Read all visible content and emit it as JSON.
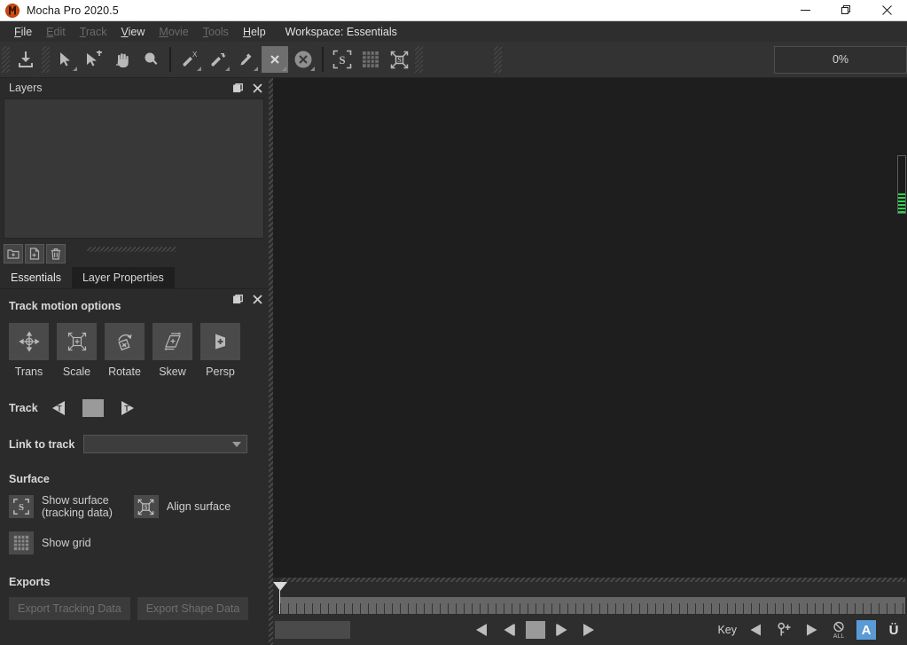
{
  "window": {
    "title": "Mocha Pro 2020.5",
    "logo_icon": "mocha-logo-icon",
    "controls": {
      "minimize": "minimize-icon",
      "restore": "restore-icon",
      "close": "close-icon"
    }
  },
  "menubar": {
    "items": [
      {
        "label": "File",
        "mnemonic": "F",
        "enabled": true
      },
      {
        "label": "Edit",
        "mnemonic": "E",
        "enabled": false
      },
      {
        "label": "Track",
        "mnemonic": "T",
        "enabled": false
      },
      {
        "label": "View",
        "mnemonic": "V",
        "enabled": true
      },
      {
        "label": "Movie",
        "mnemonic": "M",
        "enabled": false
      },
      {
        "label": "Tools",
        "mnemonic": "T",
        "enabled": false
      },
      {
        "label": "Help",
        "mnemonic": "H",
        "enabled": true
      }
    ],
    "workspace": "Workspace: Essentials"
  },
  "toolbar": {
    "buttons": [
      {
        "name": "import-clip-icon",
        "title": "Import Clip"
      },
      {
        "name": "select-tool-icon",
        "title": "Select Tool"
      },
      {
        "name": "add-point-tool-icon",
        "title": "Add Point Tool"
      },
      {
        "name": "pan-hand-tool-icon",
        "title": "Pan Tool"
      },
      {
        "name": "zoom-magnifier-tool-icon",
        "title": "Zoom Tool"
      },
      {
        "name": "x-spline-tool-icon",
        "title": "X-Spline Layer Tool"
      },
      {
        "name": "bezier-spline-tool-icon",
        "title": "Bezier Spline Tool"
      },
      {
        "name": "magnetic-spline-tool-icon",
        "title": "Magnetic Spline Tool"
      },
      {
        "name": "x-square-tool-icon",
        "title": "X-Spline"
      },
      {
        "name": "x-circle-tool-icon",
        "title": "X-Circle"
      },
      {
        "name": "show-surface-icon",
        "title": "Show Surface"
      },
      {
        "name": "show-grid-icon",
        "title": "Show Grid"
      },
      {
        "name": "align-surface-icon",
        "title": "Align Surface"
      }
    ],
    "zoom_readout": "0%"
  },
  "layers_panel": {
    "title": "Layers",
    "float_icon": "float-panel-icon",
    "close_icon": "close-panel-icon",
    "actions": [
      {
        "name": "add-group-button",
        "icon": "add-folder-icon"
      },
      {
        "name": "add-layer-button",
        "icon": "add-layer-icon"
      },
      {
        "name": "delete-layer-button",
        "icon": "trash-icon"
      }
    ],
    "layers": []
  },
  "tabs": [
    {
      "label": "Essentials",
      "active": true
    },
    {
      "label": "Layer Properties",
      "active": false
    }
  ],
  "essentials": {
    "float_icon": "float-panel-icon",
    "close_icon": "close-panel-icon",
    "track_motion": {
      "title": "Track motion options",
      "options": [
        {
          "label": "Trans",
          "icon": "translate-icon"
        },
        {
          "label": "Scale",
          "icon": "scale-icon"
        },
        {
          "label": "Rotate",
          "icon": "rotate-icon"
        },
        {
          "label": "Skew",
          "icon": "skew-icon"
        },
        {
          "label": "Persp",
          "icon": "perspective-icon"
        }
      ]
    },
    "track": {
      "label": "Track",
      "backward_icon": "track-backwards-icon",
      "stop_icon": "track-stop-icon",
      "forward_icon": "track-forwards-icon"
    },
    "link_to_track": {
      "label": "Link to track",
      "value": "",
      "placeholder": "",
      "caret_icon": "chevron-down-icon"
    },
    "surface": {
      "title": "Surface",
      "show_surface_label_line1": "Show surface",
      "show_surface_label_line2": "(tracking data)",
      "show_surface_icon": "surface-s-icon",
      "align_surface_label": "Align surface",
      "align_surface_icon": "align-surface-icon",
      "show_grid_label": "Show grid",
      "show_grid_icon": "grid-icon"
    },
    "exports": {
      "title": "Exports",
      "buttons": [
        {
          "label": "Export Tracking Data",
          "enabled": false
        },
        {
          "label": "Export Shape Data",
          "enabled": false
        }
      ]
    }
  },
  "viewer": {
    "background_color": "#1e1e1e",
    "exposure_slider": {
      "name": "exposure-slider",
      "fill_color": "#27d94a"
    }
  },
  "timeline": {
    "playhead_icon": "playhead-marker-icon",
    "current_frame": 0
  },
  "transport": {
    "status_value": "",
    "controls": [
      {
        "name": "play-backward-button",
        "icon": "play-backward-icon"
      },
      {
        "name": "step-backward-button",
        "icon": "step-backward-icon"
      },
      {
        "name": "stop-button",
        "icon": "stop-icon"
      },
      {
        "name": "step-forward-button",
        "icon": "step-forward-icon"
      },
      {
        "name": "play-forward-button",
        "icon": "play-forward-icon"
      }
    ],
    "key_label": "Key",
    "key_controls": [
      {
        "name": "previous-keyframe-button",
        "icon": "previous-keyframe-icon"
      },
      {
        "name": "add-keyframe-button",
        "icon": "add-keyframe-icon"
      },
      {
        "name": "next-keyframe-button",
        "icon": "next-keyframe-icon"
      },
      {
        "name": "delete-all-keyframes-button",
        "icon": "delete-all-keyframes-icon",
        "sublabel": "ALL"
      }
    ],
    "auto_key_label": "A",
    "unlink_label": "Ü"
  },
  "colors": {
    "accent_blue": "#5b9bd5",
    "panel_bg": "#2b2b2b",
    "viewer_bg": "#1e1e1e",
    "titlebar_bg": "#ffffff",
    "green_meter": "#27d94a"
  }
}
